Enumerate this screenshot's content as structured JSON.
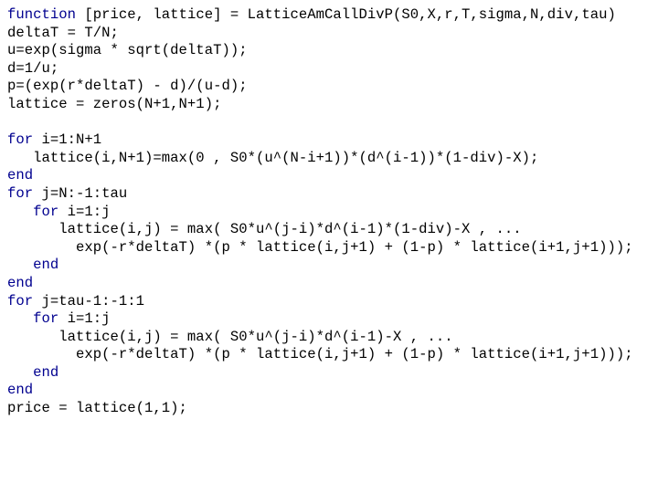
{
  "document": {
    "kind": "source-code-listing",
    "language": "MATLAB",
    "background_color": "#ffffff",
    "text_color": "#000000",
    "keyword_color": "#00008f",
    "font_size_px": 15.6,
    "line_height_px": 19.6,
    "keywords": [
      "function",
      "for",
      "end"
    ]
  },
  "code": {
    "lines": [
      {
        "id": 1,
        "keyword": "function",
        "rest": " [price, lattice] = LatticeAmCallDivP(S0,X,r,T,sigma,N,div,tau)"
      },
      {
        "id": 2,
        "keyword": "",
        "rest": "deltaT = T/N;"
      },
      {
        "id": 3,
        "keyword": "",
        "rest": "u=exp(sigma * sqrt(deltaT));"
      },
      {
        "id": 4,
        "keyword": "",
        "rest": "d=1/u;"
      },
      {
        "id": 5,
        "keyword": "",
        "rest": "p=(exp(r*deltaT) - d)/(u-d);"
      },
      {
        "id": 6,
        "keyword": "",
        "rest": "lattice = zeros(N+1,N+1);"
      },
      {
        "id": 7,
        "keyword": "",
        "rest": ""
      },
      {
        "id": 8,
        "keyword": "for",
        "rest": " i=1:N+1"
      },
      {
        "id": 9,
        "keyword": "",
        "rest": "   lattice(i,N+1)=max(0 , S0*(u^(N-i+1))*(d^(i-1))*(1-div)-X);"
      },
      {
        "id": 10,
        "keyword": "end",
        "rest": ""
      },
      {
        "id": 11,
        "keyword": "for",
        "rest": " j=N:-1:tau"
      },
      {
        "id": 12,
        "keyword": "",
        "rest": "   ",
        "keyword2": "for",
        "rest2": " i=1:j"
      },
      {
        "id": 13,
        "keyword": "",
        "rest": "      lattice(i,j) = max( S0*u^(j-i)*d^(i-1)*(1-div)-X , ..."
      },
      {
        "id": 14,
        "keyword": "",
        "rest": "        exp(-r*deltaT) *(p * lattice(i,j+1) + (1-p) * lattice(i+1,j+1)));"
      },
      {
        "id": 15,
        "keyword": "",
        "rest": "   ",
        "keyword2": "end",
        "rest2": ""
      },
      {
        "id": 16,
        "keyword": "end",
        "rest": ""
      },
      {
        "id": 17,
        "keyword": "for",
        "rest": " j=tau-1:-1:1"
      },
      {
        "id": 18,
        "keyword": "",
        "rest": "   ",
        "keyword2": "for",
        "rest2": " i=1:j"
      },
      {
        "id": 19,
        "keyword": "",
        "rest": "      lattice(i,j) = max( S0*u^(j-i)*d^(i-1)-X , ..."
      },
      {
        "id": 20,
        "keyword": "",
        "rest": "        exp(-r*deltaT) *(p * lattice(i,j+1) + (1-p) * lattice(i+1,j+1)));"
      },
      {
        "id": 21,
        "keyword": "",
        "rest": "   ",
        "keyword2": "end",
        "rest2": ""
      },
      {
        "id": 22,
        "keyword": "end",
        "rest": ""
      },
      {
        "id": 23,
        "keyword": "",
        "rest": "price = lattice(1,1);"
      }
    ]
  }
}
